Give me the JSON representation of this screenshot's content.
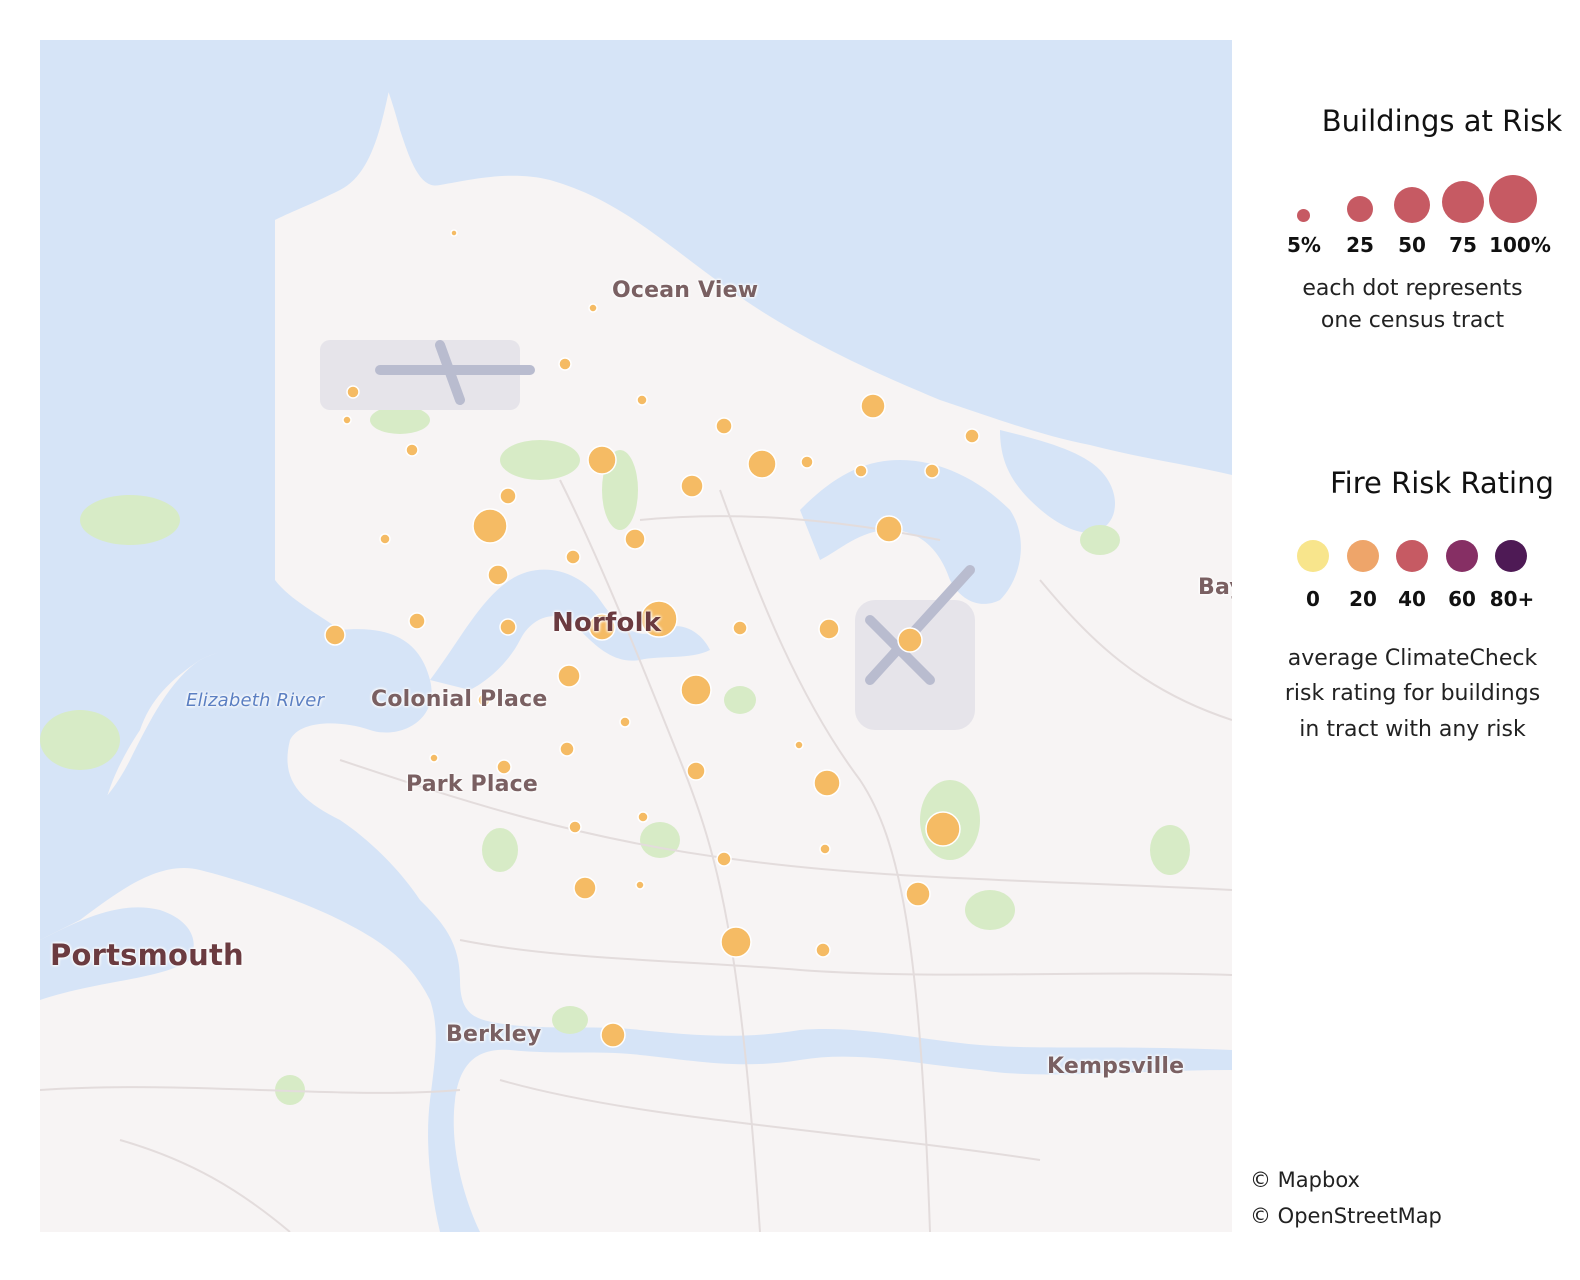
{
  "map": {
    "places": [
      {
        "key": "ocean_view",
        "text": "Ocean View"
      },
      {
        "key": "norfolk",
        "text": "Norfolk"
      },
      {
        "key": "colonial_place",
        "text": "Colonial Place"
      },
      {
        "key": "park_place",
        "text": "Park Place"
      },
      {
        "key": "portsmouth",
        "text": "Portsmouth"
      },
      {
        "key": "berkley",
        "text": "Berkley"
      },
      {
        "key": "kempsville",
        "text": "Kempsville"
      },
      {
        "key": "bay",
        "text": "Bay"
      },
      {
        "key": "elizabeth_river",
        "text": "Elizabeth River"
      }
    ],
    "dot_color": "#f5bb64",
    "water_color": "#d6e4f7",
    "land_color": "#f7f4f4",
    "park_color": "#d7ebc6"
  },
  "legend": {
    "size_title": "Buildings at Risk",
    "size_items": [
      {
        "label": "5%",
        "value": 5
      },
      {
        "label": "25",
        "value": 25
      },
      {
        "label": "50",
        "value": 50
      },
      {
        "label": "75",
        "value": 75
      },
      {
        "label": "100%",
        "value": 100
      }
    ],
    "size_color": "#c65a63",
    "size_note_1": "each dot represents",
    "size_note_2": "one census tract",
    "color_title": "Fire Risk Rating",
    "color_items": [
      {
        "label": "0",
        "color": "#f8e58c"
      },
      {
        "label": "20",
        "color": "#eea56a"
      },
      {
        "label": "40",
        "color": "#c65a63"
      },
      {
        "label": "60",
        "color": "#862f64"
      },
      {
        "label": "80+",
        "color": "#4e1a55"
      }
    ],
    "color_note_1": "average ClimateCheck",
    "color_note_2": "risk rating for buildings",
    "color_note_3": "in tract with any risk"
  },
  "attribution": {
    "mapbox": "© Mapbox",
    "osm": "© OpenStreetMap"
  }
}
